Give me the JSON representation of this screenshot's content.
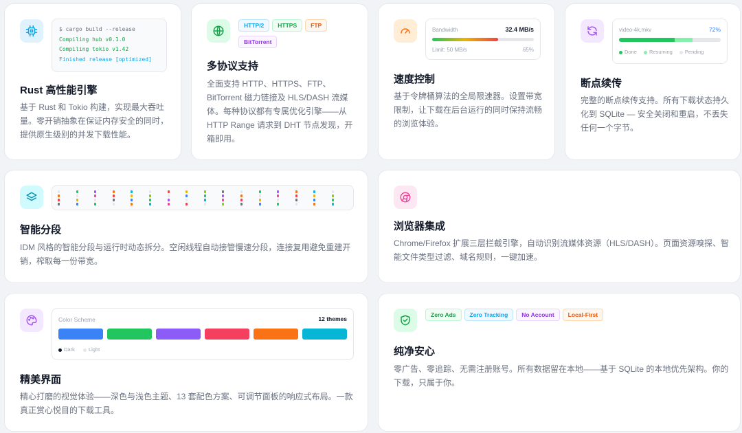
{
  "cards": {
    "rust": {
      "title": "Rust 高性能引擎",
      "desc": "基于 Rust 和 Tokio 构建，实现最大吞吐量。零开销抽象在保证内存安全的同时，提供原生级别的并发下载性能。",
      "terminal": [
        "$ cargo build --release",
        "Compiling hub v0.1.0",
        "Compiling tokio v1.42",
        "Finished release [optimized]"
      ]
    },
    "protocols": {
      "title": "多协议支持",
      "desc": "全面支持 HTTP、HTTPS、FTP、BitTorrent 磁力链接及 HLS/DASH 流媒体。每种协议都有专属优化引擎——从 HTTP Range 请求到 DHT 节点发现，开箱即用。",
      "tags": [
        "HTTP/2",
        "HTTPS",
        "FTP",
        "BitTorrent"
      ]
    },
    "speed": {
      "title": "速度控制",
      "desc": "基于令牌桶算法的全局限速器。设置带宽限制，让下载在后台运行的同时保持流畅的浏览体验。",
      "bandwidth_label": "Bandwidth",
      "bandwidth_value": "32.4 MB/s",
      "limit_label": "Limit: 50 MB/s",
      "percent_label": "65%",
      "fill": 0.65
    },
    "resume": {
      "title": "断点续传",
      "desc": "完整的断点续传支持。所有下载状态持久化到 SQLite — 安全关闭和重启，不丢失任何一个字节。",
      "file": "video-4k.mkv",
      "percent_label": "72%",
      "done_fraction": 0.55,
      "resuming_fraction": 0.17,
      "legend": [
        "Done",
        "Resuming",
        "Pending"
      ]
    },
    "segments": {
      "title": "智能分段",
      "desc": "IDM 风格的智能分段与运行时动态拆分。空闲线程自动接管慢速分段，连接复用避免重建开销，榨取每一份带宽。"
    },
    "browser": {
      "title": "浏览器集成",
      "desc": "Chrome/Firefox 扩展三层拦截引擎，自动识别流媒体资源（HLS/DASH）。页面资源嗅探、智能文件类型过滤、域名规则，一键加速。"
    },
    "ui": {
      "title": "精美界面",
      "desc": "精心打磨的视觉体验——深色与浅色主题、13 套配色方案、可调节面板的响应式布局。一款真正赏心悦目的下载工具。",
      "scheme_label": "Color Scheme",
      "themes_count": "12 themes",
      "dark_label": "Dark",
      "light_label": "Light",
      "swatches": [
        "#3b82f6",
        "#22c55e",
        "#8b5cf6",
        "#f43f5e",
        "#f97316",
        "#06b6d4"
      ]
    },
    "clean": {
      "title": "纯净安心",
      "desc": "零广告、零追踪、无需注册账号。所有数据留在本地——基于 SQLite 的本地优先架构。你的下载，只属于你。",
      "tags": [
        "Zero Ads",
        "Zero Tracking",
        "No Account",
        "Local-First"
      ]
    }
  },
  "colors": {
    "accent_green": "#22c55e",
    "accent_blue": "#3b82f6"
  }
}
